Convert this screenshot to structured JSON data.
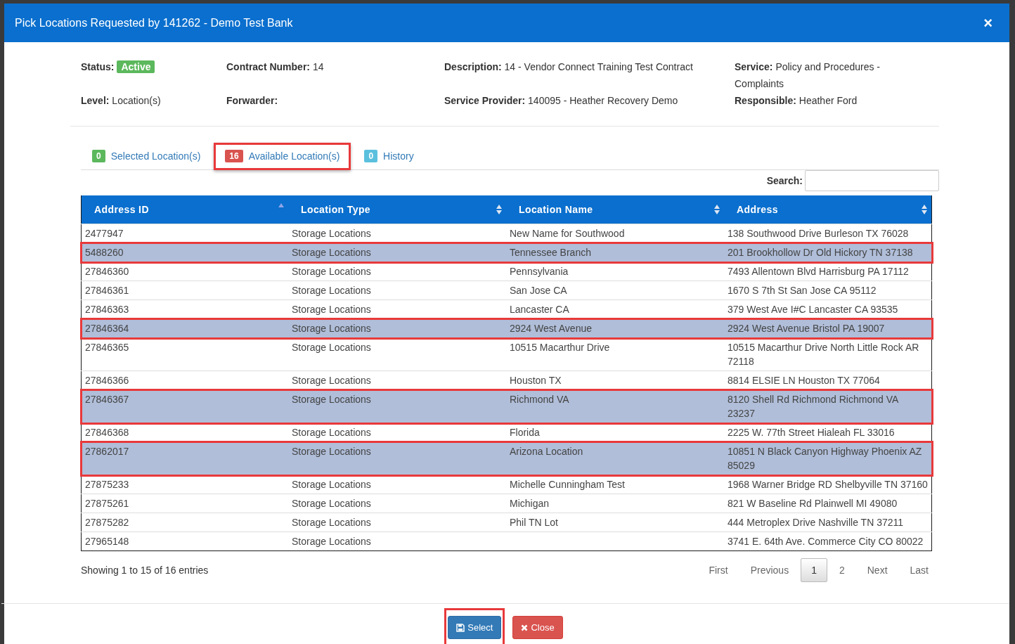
{
  "dialog": {
    "title": "Pick Locations Requested by 141262 - Demo Test Bank",
    "close": "×"
  },
  "info": [
    {
      "label": "Status:",
      "badge": "Active"
    },
    {
      "label": "Contract Number:",
      "value": "14"
    },
    {
      "label": "Description:",
      "value": "14 - Vendor Connect Training Test Contract"
    },
    {
      "label": "Service:",
      "value": "Policy and Procedures - Complaints"
    },
    {
      "label": "Level:",
      "value": "Location(s)"
    },
    {
      "label": "Forwarder:"
    },
    {
      "label": "Service Provider:",
      "value": "140095 - Heather Recovery Demo"
    },
    {
      "label": "Responsible:",
      "value": "Heather Ford"
    }
  ],
  "tabs": [
    {
      "count": "0",
      "label": "Selected Location(s)",
      "color": "#5cb85c",
      "selected": false,
      "outlined": false
    },
    {
      "count": "16",
      "label": "Available Location(s)",
      "color": "#d9534f",
      "selected": true,
      "outlined": true
    },
    {
      "count": "0",
      "label": "History",
      "color": "#5bc0de",
      "selected": false,
      "outlined": false
    }
  ],
  "search": {
    "label": "Search:"
  },
  "table": {
    "columns": [
      {
        "label": "Address ID",
        "sorted": true
      },
      {
        "label": "Location Type",
        "sorted": false
      },
      {
        "label": "Location Name",
        "sorted": false
      },
      {
        "label": "Address",
        "sorted": false
      }
    ],
    "rows": [
      {
        "cells": [
          "2477947",
          "Storage Locations",
          "New Name for Southwood",
          "138 Southwood Drive Burleson TX 76028"
        ],
        "selected": false
      },
      {
        "cells": [
          "5488260",
          "Storage Locations",
          "Tennessee Branch",
          "201 Brookhollow Dr Old Hickory TN 37138"
        ],
        "selected": true
      },
      {
        "cells": [
          "27846360",
          "Storage Locations",
          "Pennsylvania",
          "7493 Allentown Blvd Harrisburg PA 17112"
        ],
        "selected": false
      },
      {
        "cells": [
          "27846361",
          "Storage Locations",
          "San Jose CA",
          "1670 S 7th St San Jose CA 95112"
        ],
        "selected": false
      },
      {
        "cells": [
          "27846363",
          "Storage Locations",
          "Lancaster CA",
          "379 West Ave I#C Lancaster CA 93535"
        ],
        "selected": false
      },
      {
        "cells": [
          "27846364",
          "Storage Locations",
          "2924 West Avenue",
          "2924 West Avenue Bristol PA 19007"
        ],
        "selected": true
      },
      {
        "cells": [
          "27846365",
          "Storage Locations",
          "10515 Macarthur Drive",
          "10515 Macarthur Drive North Little Rock AR 72118"
        ],
        "selected": false
      },
      {
        "cells": [
          "27846366",
          "Storage Locations",
          "Houston TX",
          "8814 ELSIE LN Houston TX 77064"
        ],
        "selected": false
      },
      {
        "cells": [
          "27846367",
          "Storage Locations",
          "Richmond VA",
          "8120 Shell Rd Richmond Richmond VA 23237"
        ],
        "selected": true
      },
      {
        "cells": [
          "27846368",
          "Storage Locations",
          "Florida",
          "2225 W. 77th Street Hialeah FL 33016"
        ],
        "selected": false
      },
      {
        "cells": [
          "27862017",
          "Storage Locations",
          "Arizona Location",
          "10851 N Black Canyon Highway Phoenix AZ 85029"
        ],
        "selected": true
      },
      {
        "cells": [
          "27875233",
          "Storage Locations",
          "Michelle Cunningham Test",
          "1968 Warner Bridge RD Shelbyville TN 37160"
        ],
        "selected": false
      },
      {
        "cells": [
          "27875261",
          "Storage Locations",
          "Michigan",
          "821 W Baseline Rd Plainwell MI 49080"
        ],
        "selected": false
      },
      {
        "cells": [
          "27875282",
          "Storage Locations",
          "Phil TN Lot",
          "444 Metroplex Drive Nashville TN 37211"
        ],
        "selected": false
      },
      {
        "cells": [
          "27965148",
          "Storage Locations",
          "",
          "3741 E. 64th Ave. Commerce City CO 80022"
        ],
        "selected": false
      }
    ]
  },
  "summary": "Showing 1 to 15 of 16 entries",
  "pagination": [
    {
      "label": "First",
      "selected": false
    },
    {
      "label": "Previous",
      "selected": false
    },
    {
      "label": "1",
      "selected": true
    },
    {
      "label": "2",
      "selected": false
    },
    {
      "label": "Next",
      "selected": false
    },
    {
      "label": "Last",
      "selected": false
    }
  ],
  "buttons": [
    {
      "kind": "primary",
      "label": "Select",
      "outlined": true
    },
    {
      "kind": "danger",
      "label": "Close",
      "outlined": false
    }
  ]
}
